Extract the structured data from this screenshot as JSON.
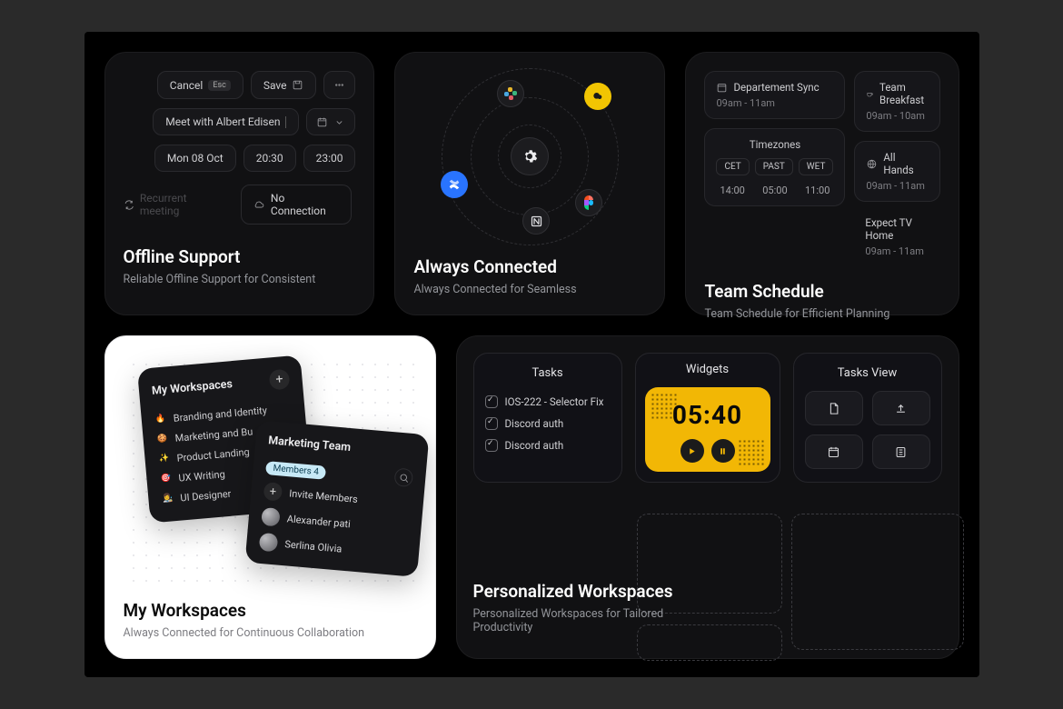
{
  "offline": {
    "title": "Offline Support",
    "subtitle": "Reliable Offline Support for Consistent",
    "cancel": "Cancel",
    "cancel_key": "Esc",
    "save": "Save",
    "meeting_name": "Meet with Albert Edisen",
    "date": "Mon 08 Oct",
    "start": "20:30",
    "end": "23:00",
    "recurring": "Recurrent meeting",
    "no_conn": "No Connection"
  },
  "connected": {
    "title": "Always Connected",
    "subtitle": "Always Connected for Seamless"
  },
  "schedule": {
    "title": "Team Schedule",
    "subtitle": "Team Schedule for Efficient Planning",
    "dept_label": "Departement Sync",
    "dept_time": "09am - 11am",
    "tz_label": "Timezones",
    "tz_tabs": [
      "CET",
      "PAST",
      "WET"
    ],
    "tz_times": [
      "14:00",
      "05:00",
      "11:00"
    ],
    "right": [
      {
        "label": "Team Breakfast",
        "time": "09am - 10am"
      },
      {
        "label": "All Hands",
        "time": "09am - 11am"
      },
      {
        "label": "Expect TV Home",
        "time": "09am - 11am"
      }
    ]
  },
  "workspaces": {
    "title": "My Workspaces",
    "subtitle": "Always Connected for Continuous Collaboration",
    "panelA": {
      "title": "My Workspaces",
      "items": [
        {
          "emoji": "🔥",
          "name": "Branding and Identity"
        },
        {
          "emoji": "🍪",
          "name": "Marketing and Bu"
        },
        {
          "emoji": "✨",
          "name": "Product Landing"
        },
        {
          "emoji": "🎯",
          "name": "UX Writing"
        },
        {
          "emoji": "👩‍🎨",
          "name": "UI Designer"
        }
      ]
    },
    "panelB": {
      "title": "Marketing Team",
      "badge": "Members 4",
      "invite": "Invite Members",
      "members": [
        "Alexander pati",
        "Serlina Olivia"
      ]
    }
  },
  "pw": {
    "title": "Personalized Workspaces",
    "subtitle": "Personalized Workspaces for Tailored Productivity",
    "tasks_title": "Tasks",
    "task_items": [
      "IOS-222 - Selector Fix",
      "Discord auth",
      "Discord auth"
    ],
    "widgets_title": "Widgets",
    "timer": "05:40",
    "views_title": "Tasks View"
  }
}
